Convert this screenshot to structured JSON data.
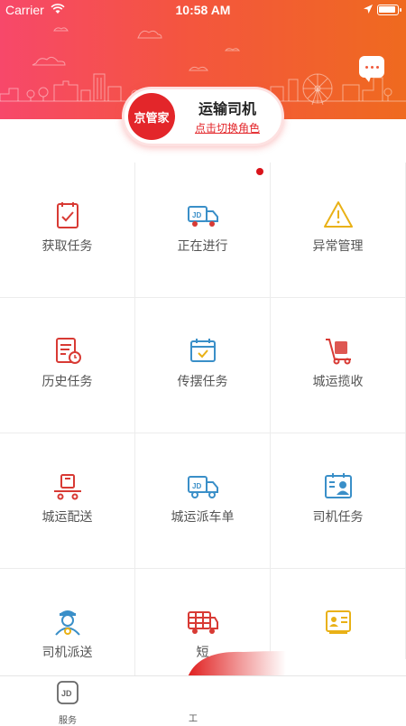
{
  "status_bar": {
    "carrier": "Carrier",
    "time": "10:58 AM"
  },
  "header": {
    "chat_icon": "chat-bubble-icon"
  },
  "role": {
    "logo_text": "京管家",
    "name": "运输司机",
    "switch_label": "点击切换角色"
  },
  "colors": {
    "accent_red": "#e3262a",
    "icon_blue": "#3a8fc8",
    "icon_yellow": "#e9b116"
  },
  "grid": {
    "items": [
      {
        "label": "获取任务",
        "icon": "clipboard-check-icon"
      },
      {
        "label": "正在进行",
        "icon": "jd-truck-icon"
      },
      {
        "label": "异常管理",
        "icon": "warning-triangle-icon"
      },
      {
        "label": "历史任务",
        "icon": "history-clipboard-icon"
      },
      {
        "label": "传摆任务",
        "icon": "calendar-check-icon"
      },
      {
        "label": "城运揽收",
        "icon": "hand-truck-icon"
      },
      {
        "label": "城运配送",
        "icon": "package-cart-icon"
      },
      {
        "label": "城运派车单",
        "icon": "jd-truck-outline-icon"
      },
      {
        "label": "司机任务",
        "icon": "driver-clipboard-icon"
      },
      {
        "label": "司机派送",
        "icon": "driver-person-icon"
      },
      {
        "label": "短",
        "icon": "delivery-boxes-truck-icon"
      },
      {
        "label": "",
        "icon": "id-card-icon"
      }
    ]
  },
  "tabbar": {
    "service_label": "服务",
    "work_label": "工",
    "service_icon": "jd-tab-icon"
  }
}
